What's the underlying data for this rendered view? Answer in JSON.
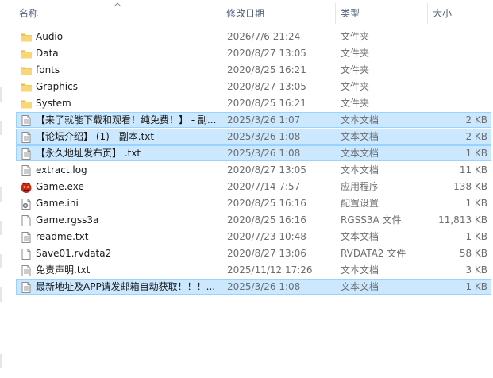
{
  "columns": {
    "name": "名称",
    "date": "修改日期",
    "type": "类型",
    "size": "大小"
  },
  "colors": {
    "selection_bg": "#cce8ff",
    "selection_border": "#99d1ff",
    "folder": "#f8d775",
    "header_text": "#4c607a"
  },
  "files": [
    {
      "name": "Audio",
      "date": "2026/7/6 21:24",
      "type": "文件夹",
      "size": "",
      "icon": "folder-icon",
      "selected": false
    },
    {
      "name": "Data",
      "date": "2020/8/27 13:05",
      "type": "文件夹",
      "size": "",
      "icon": "folder-icon",
      "selected": false
    },
    {
      "name": "fonts",
      "date": "2020/8/25 16:21",
      "type": "文件夹",
      "size": "",
      "icon": "folder-icon",
      "selected": false
    },
    {
      "name": "Graphics",
      "date": "2020/8/27 13:05",
      "type": "文件夹",
      "size": "",
      "icon": "folder-icon",
      "selected": false
    },
    {
      "name": "System",
      "date": "2020/8/25 16:21",
      "type": "文件夹",
      "size": "",
      "icon": "folder-icon",
      "selected": false
    },
    {
      "name": "【来了就能下载和观看！纯免费！】 - 副...",
      "date": "2025/3/26 1:07",
      "type": "文本文档",
      "size": "2 KB",
      "icon": "text-file-icon",
      "selected": true
    },
    {
      "name": "【论坛介绍】 (1) - 副本.txt",
      "date": "2025/3/26 1:08",
      "type": "文本文档",
      "size": "2 KB",
      "icon": "text-file-icon",
      "selected": true
    },
    {
      "name": "【永久地址发布页】 .txt",
      "date": "2025/3/26 1:08",
      "type": "文本文档",
      "size": "1 KB",
      "icon": "text-file-icon",
      "selected": true
    },
    {
      "name": "extract.log",
      "date": "2020/8/27 13:05",
      "type": "文本文档",
      "size": "11 KB",
      "icon": "text-file-icon",
      "selected": false
    },
    {
      "name": "Game.exe",
      "date": "2020/7/14 7:57",
      "type": "应用程序",
      "size": "138 KB",
      "icon": "game-exe-icon",
      "selected": false
    },
    {
      "name": "Game.ini",
      "date": "2020/8/25 16:16",
      "type": "配置设置",
      "size": "1 KB",
      "icon": "settings-file-icon",
      "selected": false
    },
    {
      "name": "Game.rgss3a",
      "date": "2020/8/25 16:16",
      "type": "RGSS3A 文件",
      "size": "11,813 KB",
      "icon": "blank-file-icon",
      "selected": false
    },
    {
      "name": "readme.txt",
      "date": "2020/7/23 10:48",
      "type": "文本文档",
      "size": "1 KB",
      "icon": "text-file-icon",
      "selected": false
    },
    {
      "name": "Save01.rvdata2",
      "date": "2020/8/27 13:06",
      "type": "RVDATA2 文件",
      "size": "58 KB",
      "icon": "blank-file-icon",
      "selected": false
    },
    {
      "name": "免责声明.txt",
      "date": "2025/11/12 17:26",
      "type": "文本文档",
      "size": "3 KB",
      "icon": "text-file-icon",
      "selected": false
    },
    {
      "name": "最新地址及APP请发邮箱自动获取！！！...",
      "date": "2025/3/26 1:08",
      "type": "文本文档",
      "size": "1 KB",
      "icon": "text-file-icon",
      "selected": true
    }
  ]
}
